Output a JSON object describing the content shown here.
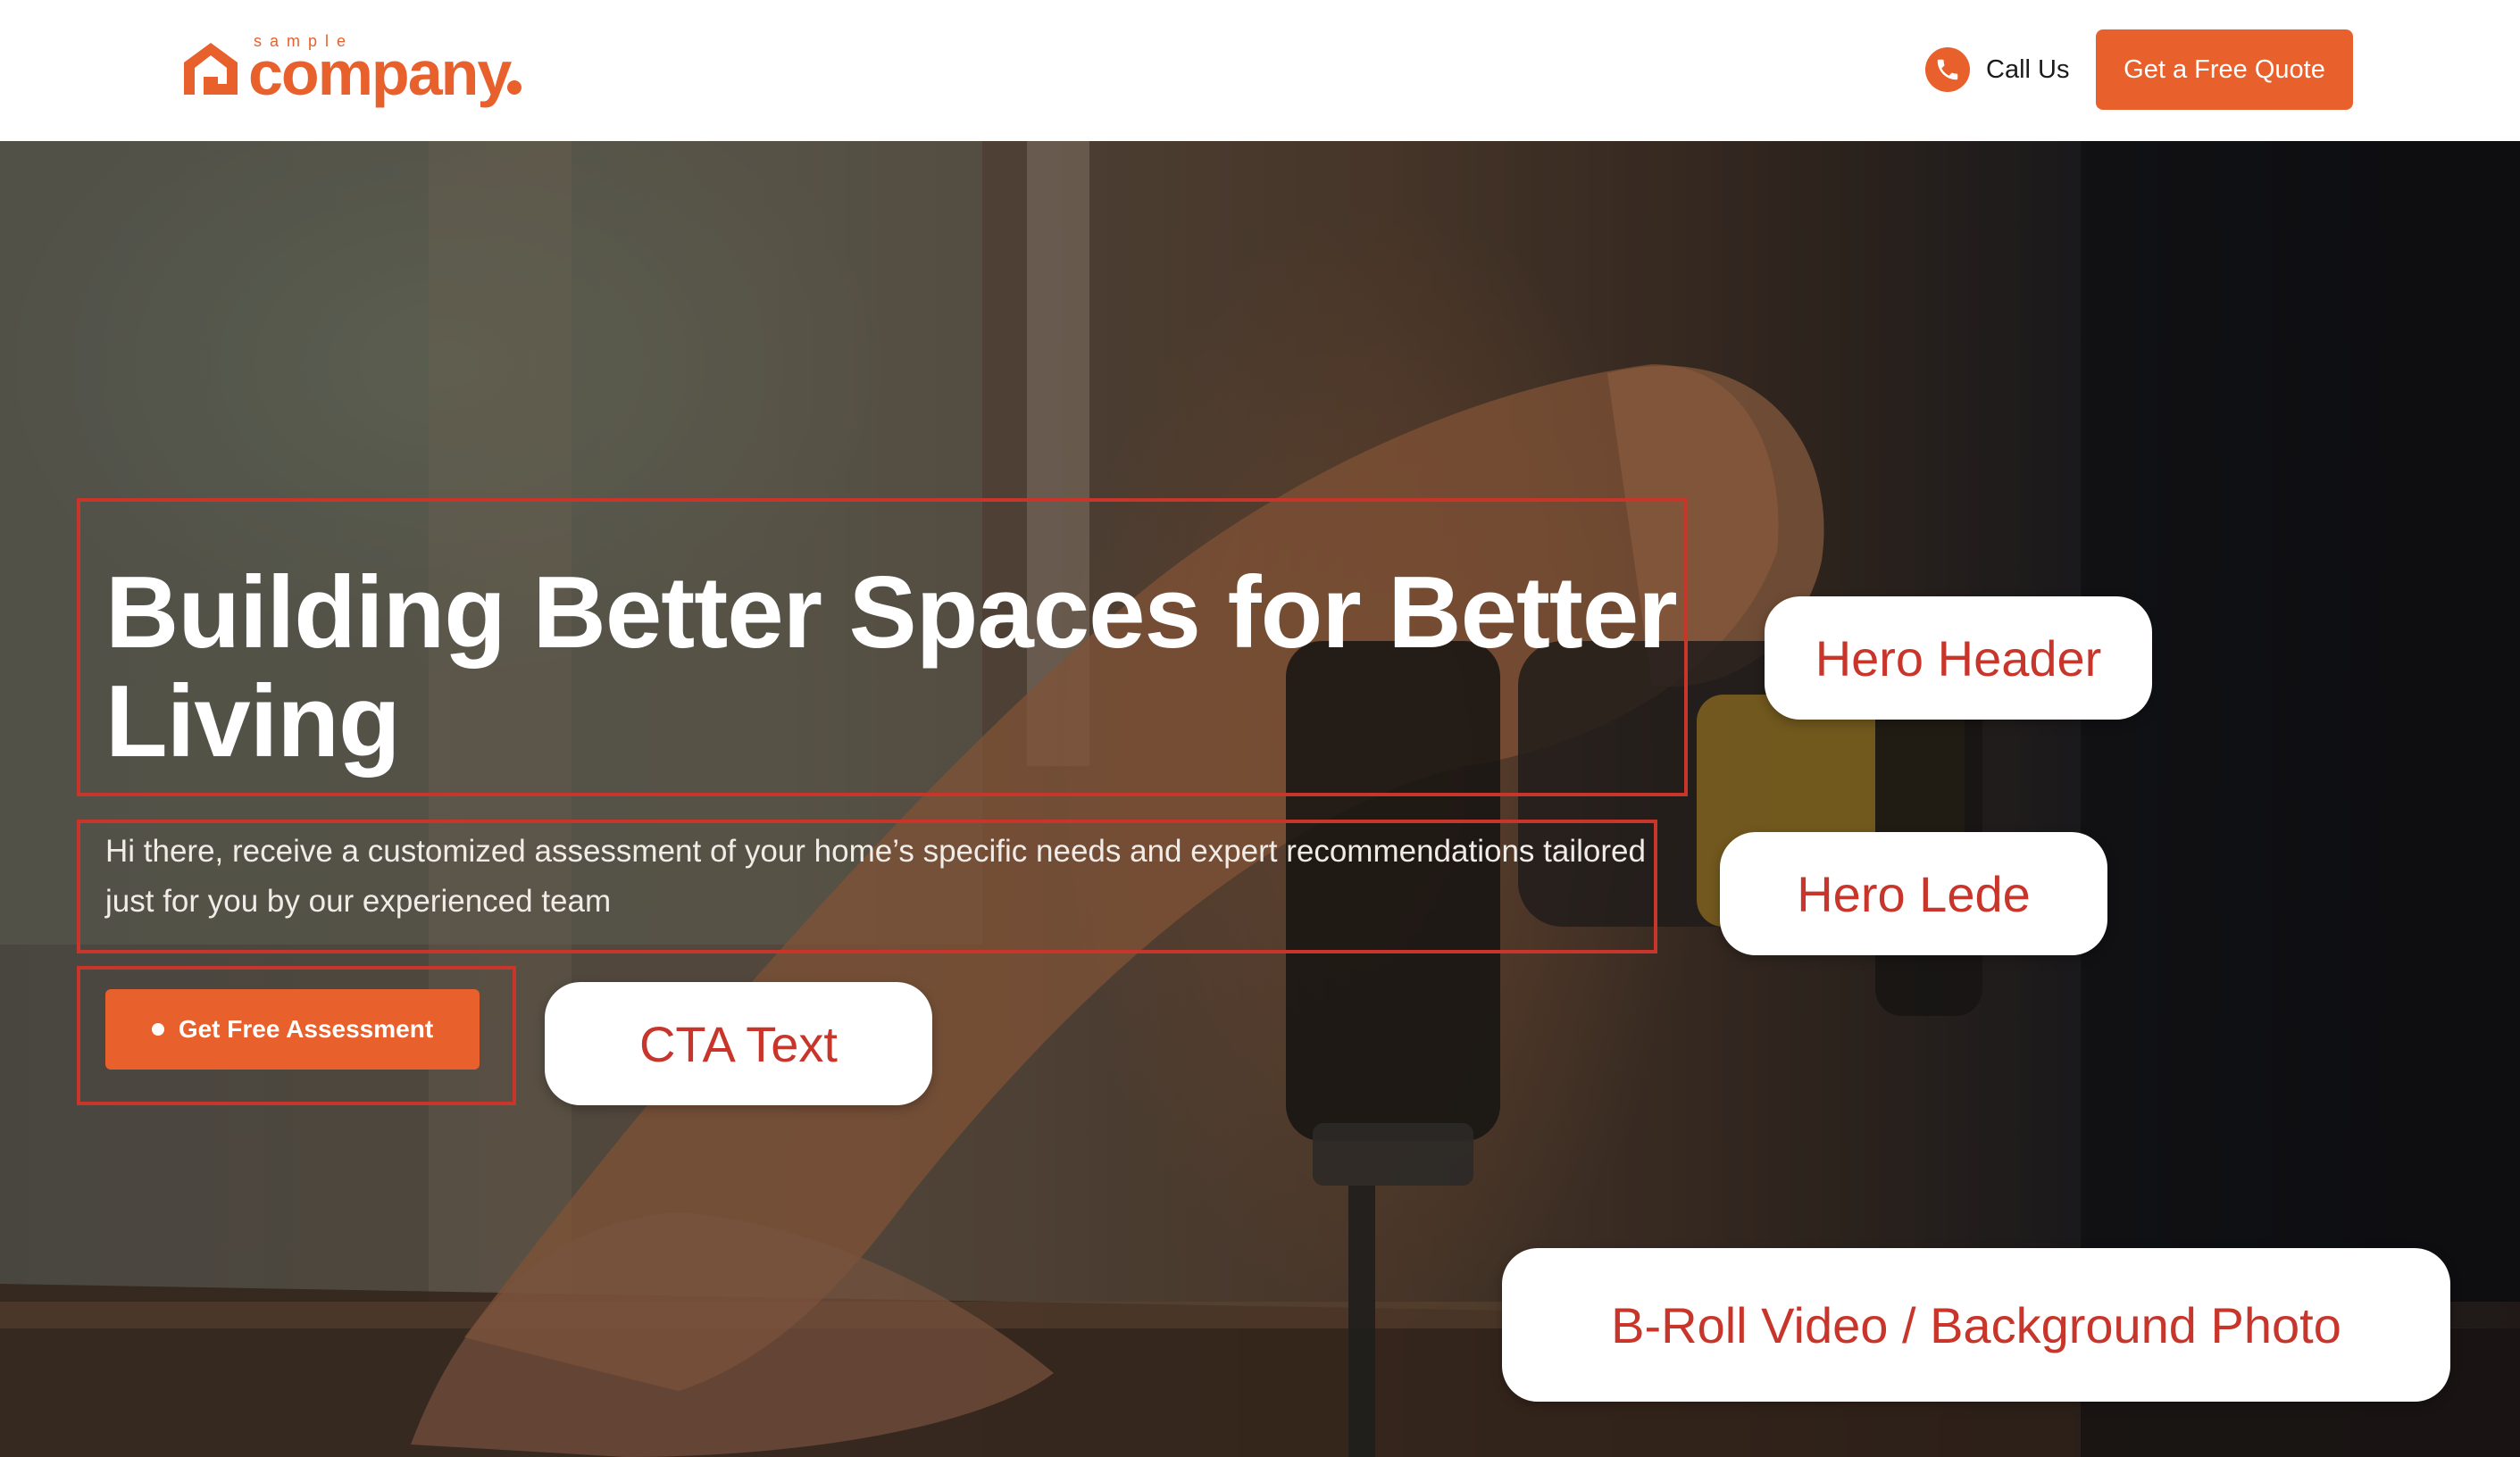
{
  "header": {
    "logo": {
      "small_text": "sample",
      "wordmark": "company",
      "icon": "house-logo-icon"
    },
    "call": {
      "icon": "phone-icon",
      "label": "Call Us"
    },
    "quote_button": "Get a Free Quote"
  },
  "hero": {
    "title": "Building Better Spaces for Better Living",
    "lede": "Hi there, receive a customized assessment of your home’s specific needs and expert recommendations tailored just for you by our experienced team",
    "cta": {
      "label": "Get Free Assessment",
      "icon": "dot-icon"
    },
    "background": "drill-photo"
  },
  "annotations": {
    "hero_header": "Hero Header",
    "hero_lede": "Hero Lede",
    "cta_text": "CTA Text",
    "background": "B-Roll Video / Background Photo"
  },
  "colors": {
    "accent": "#e8602b",
    "annotation": "#c8352a"
  }
}
